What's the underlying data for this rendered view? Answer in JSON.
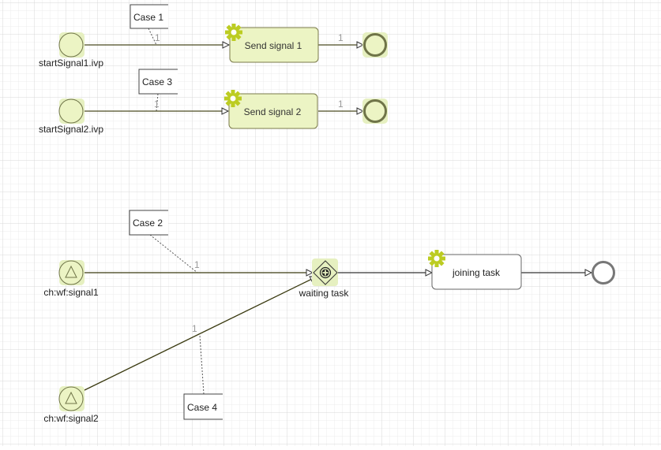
{
  "colors": {
    "task_fill": "#ecf4c4",
    "task_stroke": "#7a7a4a",
    "gear": "#bccc22",
    "flow": "#4a4a20",
    "highlight": "#e6f0c0",
    "end_stroke": "#6f7448",
    "grid": "#e2e2e2"
  },
  "events": {
    "start1": {
      "label": "startSignal1.ivp"
    },
    "start2": {
      "label": "startSignal2.ivp"
    },
    "signal1": {
      "label": "ch:wf:signal1",
      "icon": "triangle-icon"
    },
    "signal2": {
      "label": "ch:wf:signal2",
      "icon": "triangle-icon"
    }
  },
  "tasks": {
    "send1": {
      "label": "Send signal 1",
      "icon": "gear-icon"
    },
    "send2": {
      "label": "Send signal 2",
      "icon": "gear-icon"
    },
    "joining": {
      "label": "joining task",
      "icon": "gear-icon"
    }
  },
  "gateway": {
    "label": "waiting task",
    "icon": "parallel-plus-icon"
  },
  "annotations": {
    "case1": "Case 1",
    "case2": "Case 2",
    "case3": "Case 3",
    "case4": "Case 4"
  },
  "flow_labels": {
    "f1": "1",
    "f2": "1",
    "f3": "1",
    "f4": "1",
    "f5": "1",
    "f6": "1"
  }
}
